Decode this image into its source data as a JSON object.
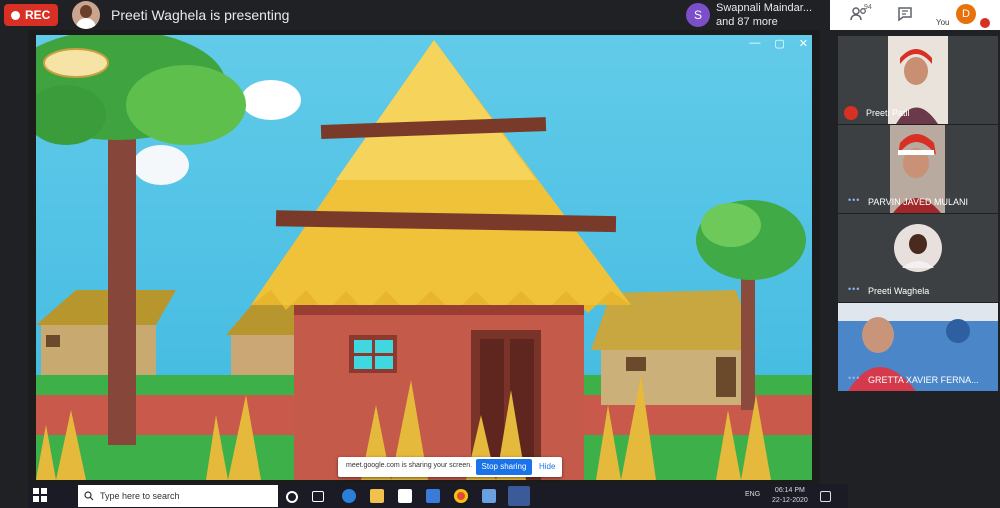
{
  "topbar": {
    "rec_label": "REC",
    "presenter_text": "Preeti Waghela is presenting",
    "people_chip": {
      "initial": "S",
      "line1": "Swapnali Maindar...",
      "line2": "and 87 more"
    },
    "participants_badge": "94",
    "self_label": "You",
    "self_initial": "D"
  },
  "shared_window": {
    "controls": [
      "—",
      "▢",
      "✕"
    ]
  },
  "sharing_bar": {
    "message": "meet.google.com is sharing your screen.",
    "stop_label": "Stop sharing",
    "hide_label": "Hide"
  },
  "taskbar": {
    "search_placeholder": "Type here to search",
    "lang": "ENG",
    "time": "06:14 PM",
    "date": "22-12-2020"
  },
  "tiles": [
    {
      "name": "Preeti Patil"
    },
    {
      "name": "PARVIN JAVED MULANI"
    },
    {
      "name": "Preeti Waghela"
    },
    {
      "name": "GRETTA XAVIER FERNA..."
    }
  ],
  "colors": {
    "rec": "#d93025",
    "accent": "#1a73e8",
    "self_avatar": "#e8710a"
  }
}
